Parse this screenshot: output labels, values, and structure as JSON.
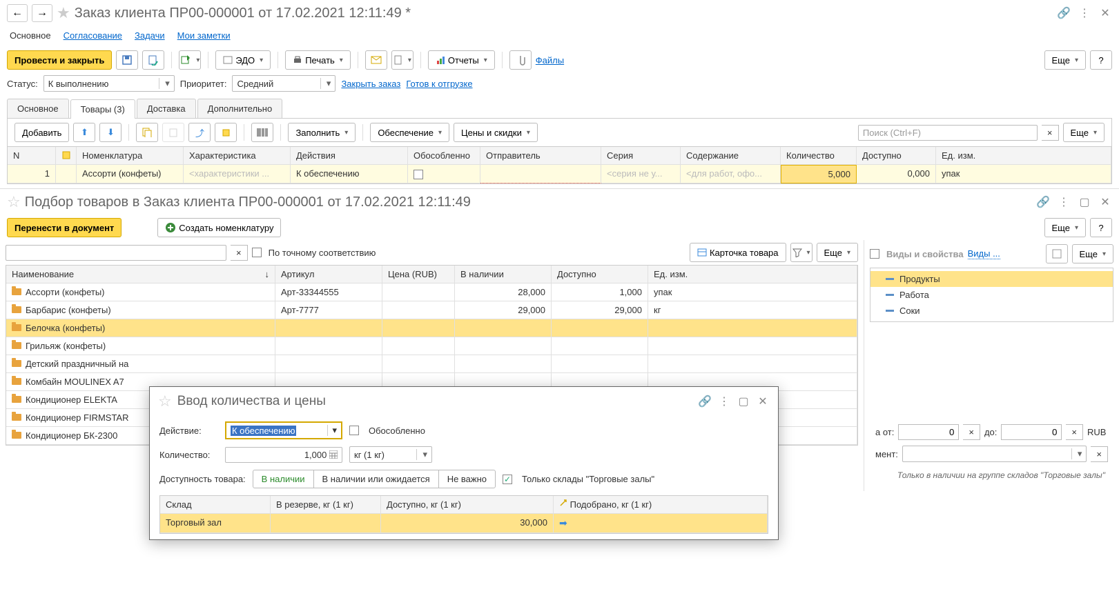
{
  "order_window": {
    "title": "Заказ клиента ПР00-000001 от 17.02.2021 12:11:49 *",
    "subnav": [
      "Основное",
      "Согласование",
      "Задачи",
      "Мои заметки"
    ],
    "toolbar": {
      "post_close": "Провести и закрыть",
      "edo": "ЭДО",
      "print": "Печать",
      "reports": "Отчеты",
      "files": "Файлы",
      "more": "Еще"
    },
    "status_label": "Статус:",
    "status_value": "К выполнению",
    "priority_label": "Приоритет:",
    "priority_value": "Средний",
    "link_close_order": "Закрыть заказ",
    "link_ready_ship": "Готов к отгрузке",
    "tabs": [
      "Основное",
      "Товары (3)",
      "Доставка",
      "Дополнительно"
    ],
    "goods_toolbar": {
      "add": "Добавить",
      "fill": "Заполнить",
      "provide": "Обеспечение",
      "prices": "Цены и скидки",
      "search_ph": "Поиск (Ctrl+F)",
      "more": "Еще"
    },
    "goods_cols": [
      "N",
      "",
      "Номенклатура",
      "Характеристика",
      "Действия",
      "Обособленно",
      "Отправитель",
      "Серия",
      "Содержание",
      "Количество",
      "Доступно",
      "Ед. изм."
    ],
    "goods_row": {
      "n": "1",
      "nomen": "Ассорти (конфеты)",
      "char": "<характеристики ...",
      "action": "К обеспечению",
      "series": "<серия не у...",
      "content": "<для работ, офо...",
      "qty": "5,000",
      "avail": "0,000",
      "unit": "упак"
    }
  },
  "pick_window": {
    "title": "Подбор товаров в Заказ клиента ПР00-000001 от 17.02.2021 12:11:49",
    "transfer": "Перенести в документ",
    "create_nomen": "Создать номенклатуру",
    "more": "Еще",
    "exact_match": "По точному соответствию",
    "product_card": "Карточка товара",
    "cols": [
      "Наименование",
      "Артикул",
      "Цена (RUB)",
      "В наличии",
      "Доступно",
      "Ед. изм."
    ],
    "rows": [
      {
        "name": "Ассорти (конфеты)",
        "art": "Арт-33344555",
        "stock": "28,000",
        "avail": "1,000",
        "unit": "упак"
      },
      {
        "name": "Барбарис (конфеты)",
        "art": "Арт-7777",
        "stock": "29,000",
        "avail": "29,000",
        "unit": "кг"
      },
      {
        "name": "Белочка (конфеты)",
        "art": "",
        "stock": "",
        "avail": "",
        "unit": ""
      },
      {
        "name": "Грильяж (конфеты)",
        "art": "",
        "stock": "",
        "avail": "",
        "unit": ""
      },
      {
        "name": "Детский праздничный на",
        "art": "",
        "stock": "",
        "avail": "",
        "unit": ""
      },
      {
        "name": "Комбайн MOULINEX  A7",
        "art": "",
        "stock": "",
        "avail": "",
        "unit": ""
      },
      {
        "name": "Кондиционер ELEKTA",
        "art": "",
        "stock": "",
        "avail": "",
        "unit": ""
      },
      {
        "name": "Кондиционер FIRMSTAR",
        "art": "",
        "stock": "",
        "avail": "",
        "unit": ""
      },
      {
        "name": "Кондиционер БК-2300",
        "art": "",
        "stock": "",
        "avail": "",
        "unit": ""
      }
    ],
    "right": {
      "header": "Виды и свойства",
      "link": "Виды ...",
      "more": "Еще",
      "tree": [
        "Продукты",
        "Работа",
        "Соки"
      ],
      "from_label": "а от:",
      "to_label": "до:",
      "val_from": "0",
      "val_to": "0",
      "currency": "RUB",
      "ment_label": "мент:",
      "hint": "Только в наличии на группе складов \"Торговые залы\""
    }
  },
  "modal": {
    "title": "Ввод количества и цены",
    "action_label": "Действие:",
    "action_value": "К обеспечению",
    "isolated": "Обособленно",
    "qty_label": "Количество:",
    "qty_value": "1,000",
    "unit_value": "кг (1 кг)",
    "avail_label": "Доступность товара:",
    "seg": [
      "В наличии",
      "В наличии или ожидается",
      "Не важно"
    ],
    "only_trade": "Только склады \"Торговые залы\"",
    "cols": [
      "Склад",
      "В резерве, кг (1 кг)",
      "Доступно, кг (1 кг)",
      "Подобрано, кг (1 кг)"
    ],
    "row": {
      "warehouse": "Торговый зал",
      "avail": "30,000"
    }
  }
}
